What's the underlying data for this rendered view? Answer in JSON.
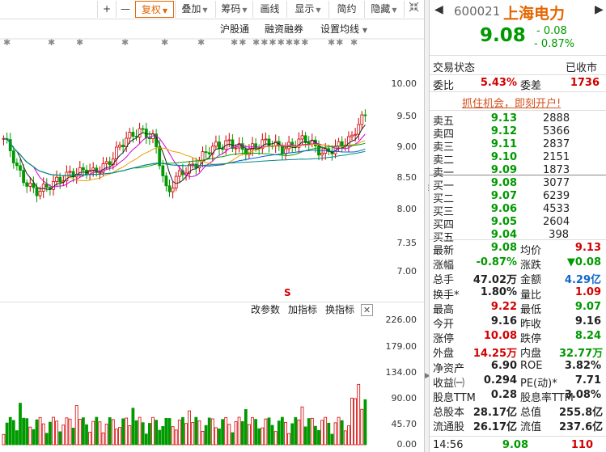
{
  "toolbar": {
    "buttons": [
      "+",
      "—",
      "复权",
      "叠加",
      "筹码",
      "画线",
      "显示",
      "简约",
      "隐藏"
    ],
    "collapse_icon": "collapse-icon"
  },
  "subbar": {
    "hgt": "沪股通",
    "margin": "融资融券",
    "ma_settings": "设置均线"
  },
  "main_axis": [
    "10.00",
    "9.50",
    "9.00",
    "8.50",
    "8.00",
    "7.35",
    "7.00"
  ],
  "volume_axis": [
    "226.00",
    "179.00",
    "134.00",
    "90.00",
    "45.70",
    "0.00"
  ],
  "marker": "S",
  "indicator_bar": {
    "modify": "改参数",
    "add": "加指标",
    "switch": "换指标"
  },
  "quote": {
    "code": "600021",
    "name": "上海电力",
    "price": "9.08",
    "change": "- 0.08",
    "change_pct": "- 0.87%",
    "status_label": "交易状态",
    "status_value": "已收市",
    "weibi_label": "委比",
    "weibi_value": "5.43%",
    "weicha_label": "委差",
    "weicha_value": "1736",
    "promo": "抓住机会，即刻开户!"
  },
  "asks": [
    {
      "label": "卖五",
      "price": "9.13",
      "vol": "2888"
    },
    {
      "label": "卖四",
      "price": "9.12",
      "vol": "5366"
    },
    {
      "label": "卖三",
      "price": "9.11",
      "vol": "2837"
    },
    {
      "label": "卖二",
      "price": "9.10",
      "vol": "2151"
    },
    {
      "label": "卖一",
      "price": "9.09",
      "vol": "1873"
    }
  ],
  "bids": [
    {
      "label": "买一",
      "price": "9.08",
      "vol": "3077"
    },
    {
      "label": "买二",
      "price": "9.07",
      "vol": "6239"
    },
    {
      "label": "买三",
      "price": "9.06",
      "vol": "4533"
    },
    {
      "label": "买四",
      "price": "9.05",
      "vol": "2604"
    },
    {
      "label": "买五",
      "price": "9.04",
      "vol": "398"
    }
  ],
  "stats": [
    {
      "l1": "最新",
      "v1": "9.08",
      "c1": "green",
      "l2": "均价",
      "v2": "9.13",
      "c2": "red"
    },
    {
      "l1": "涨幅",
      "v1": "-0.87%",
      "c1": "green",
      "l2": "涨跌",
      "v2": "▼0.08",
      "c2": "green"
    },
    {
      "l1": "总手",
      "v1": "47.02万",
      "c1": "black",
      "l2": "金额",
      "v2": "4.29亿",
      "c2": "blue"
    },
    {
      "l1": "换手*",
      "v1": "1.80%",
      "c1": "black",
      "l2": "量比",
      "v2": "1.09",
      "c2": "red"
    },
    {
      "l1": "最高",
      "v1": "9.22",
      "c1": "red",
      "l2": "最低",
      "v2": "9.07",
      "c2": "green"
    },
    {
      "l1": "今开",
      "v1": "9.16",
      "c1": "black",
      "l2": "昨收",
      "v2": "9.16",
      "c2": "black"
    },
    {
      "l1": "涨停",
      "v1": "10.08",
      "c1": "red",
      "l2": "跌停",
      "v2": "8.24",
      "c2": "green"
    },
    {
      "l1": "外盘",
      "v1": "14.25万",
      "c1": "red",
      "l2": "内盘",
      "v2": "32.77万",
      "c2": "green"
    },
    {
      "l1": "净资产",
      "v1": "6.90",
      "c1": "black",
      "l2": "ROE",
      "v2": "3.82%",
      "c2": "black"
    },
    {
      "l1": "收益㈠",
      "v1": "0.294",
      "c1": "black",
      "l2": "PE(动)*",
      "v2": "7.71",
      "c2": "black"
    },
    {
      "l1": "股息TTM",
      "v1": "0.28",
      "c1": "black",
      "l2": "股息率TTM",
      "v2": "3.08%",
      "c2": "black"
    },
    {
      "l1": "总股本",
      "v1": "28.17亿",
      "c1": "black",
      "l2": "总值",
      "v2": "255.8亿",
      "c2": "black"
    },
    {
      "l1": "流通股",
      "v1": "26.17亿",
      "c1": "black",
      "l2": "流值",
      "v2": "237.6亿",
      "c2": "black"
    }
  ],
  "tick": {
    "time": "14:56",
    "price": "9.08",
    "vol": "110"
  },
  "colors": {
    "up": "#d20000",
    "down": "#009900",
    "accent": "#e46600"
  }
}
